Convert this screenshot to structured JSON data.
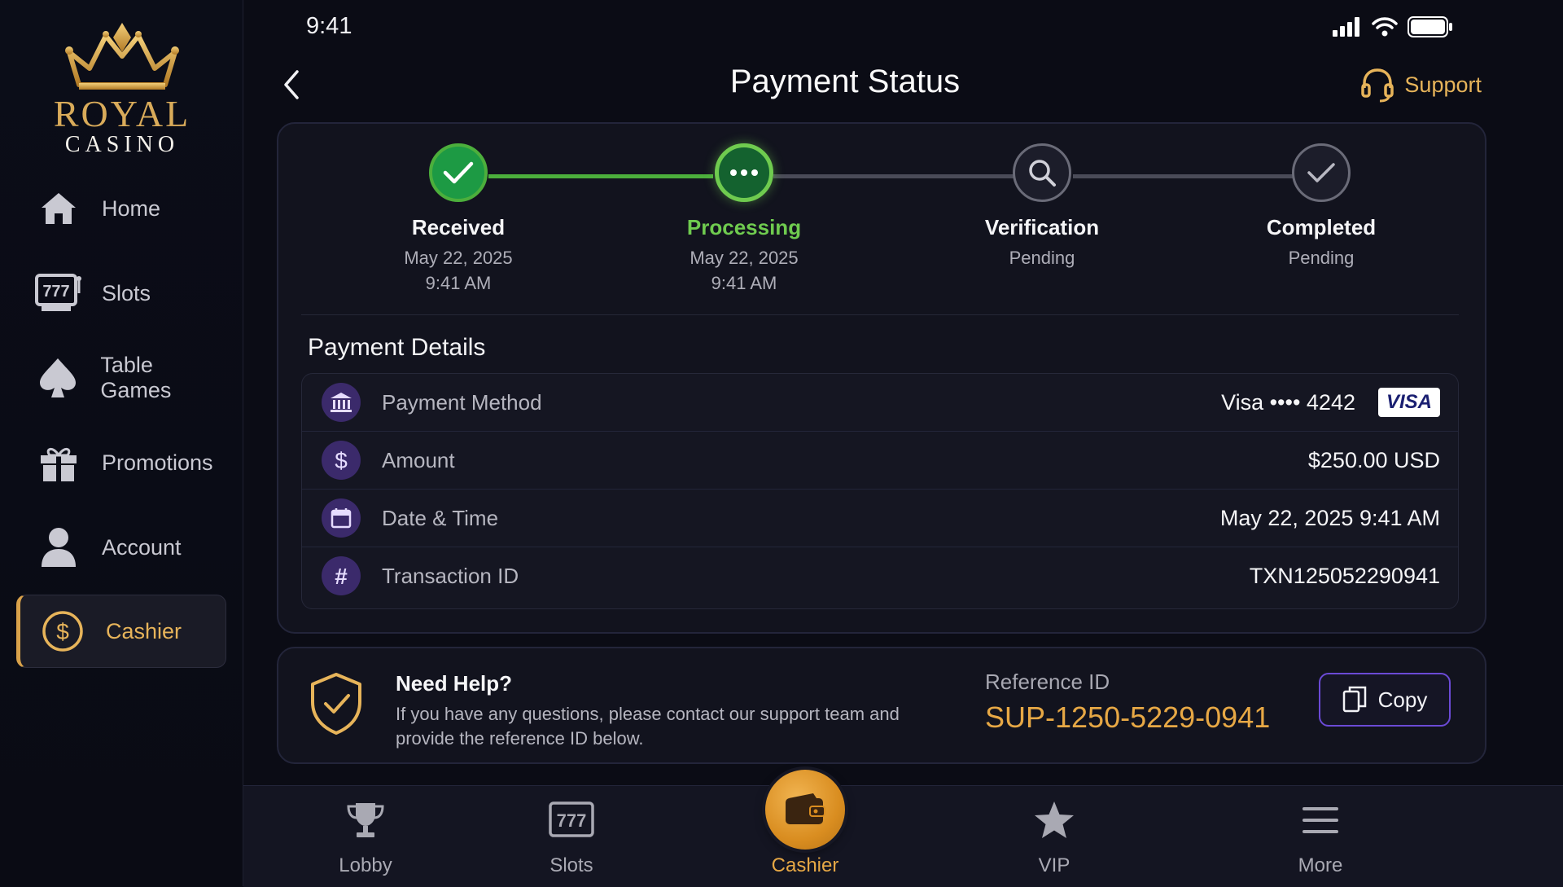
{
  "brand": {
    "name_top": "ROYAL",
    "name_bottom": "CASINO"
  },
  "sidebar": {
    "items": [
      {
        "label": "Home",
        "icon": "home-icon"
      },
      {
        "label": "Slots",
        "icon": "slot-machine-icon"
      },
      {
        "label": "Table Games",
        "icon": "spade-icon"
      },
      {
        "label": "Promotions",
        "icon": "gift-icon"
      },
      {
        "label": "Account",
        "icon": "user-icon"
      },
      {
        "label": "Cashier",
        "icon": "dollar-circle-icon",
        "active": true
      }
    ]
  },
  "status_bar": {
    "time": "9:41"
  },
  "header": {
    "title": "Payment Status",
    "support_label": "Support"
  },
  "stepper": {
    "steps": [
      {
        "label": "Received",
        "line1": "May 22, 2025",
        "line2": "9:41 AM",
        "state": "done"
      },
      {
        "label": "Processing",
        "line1": "May 22, 2025",
        "line2": "9:41 AM",
        "state": "active"
      },
      {
        "label": "Verification",
        "line1": "Pending",
        "line2": "",
        "state": "pending"
      },
      {
        "label": "Completed",
        "line1": "Pending",
        "line2": "",
        "state": "pending"
      }
    ]
  },
  "details": {
    "title": "Payment Details",
    "rows": [
      {
        "label": "Payment Method",
        "value": "Visa •••• 4242",
        "badge": "VISA",
        "icon": "bank-icon"
      },
      {
        "label": "Amount",
        "value": "$250.00 USD",
        "icon": "dollar-icon"
      },
      {
        "label": "Date & Time",
        "value": "May 22, 2025 9:41 AM",
        "icon": "calendar-icon"
      },
      {
        "label": "Transaction ID",
        "value": "TXN125052290941",
        "icon": "hash-icon"
      }
    ]
  },
  "help": {
    "title": "Need Help?",
    "text": "If you have any questions, please contact our support team and provide the reference ID below.",
    "ref_label": "Reference ID",
    "ref_value": "SUP-1250-5229-0941",
    "copy_label": "Copy"
  },
  "tabbar": {
    "tabs": [
      {
        "label": "Lobby",
        "icon": "trophy-icon"
      },
      {
        "label": "Slots",
        "icon": "slot-777-icon"
      },
      {
        "label": "Cashier",
        "icon": "wallet-icon",
        "active": true
      },
      {
        "label": "VIP",
        "icon": "star-icon"
      },
      {
        "label": "More",
        "icon": "menu-icon"
      }
    ]
  },
  "colors": {
    "accent_gold": "#e7a845",
    "success_green": "#2fa84f",
    "processing_green": "#6fcb4f",
    "purple": "#6b4ad6",
    "background": "#0b0c15"
  }
}
